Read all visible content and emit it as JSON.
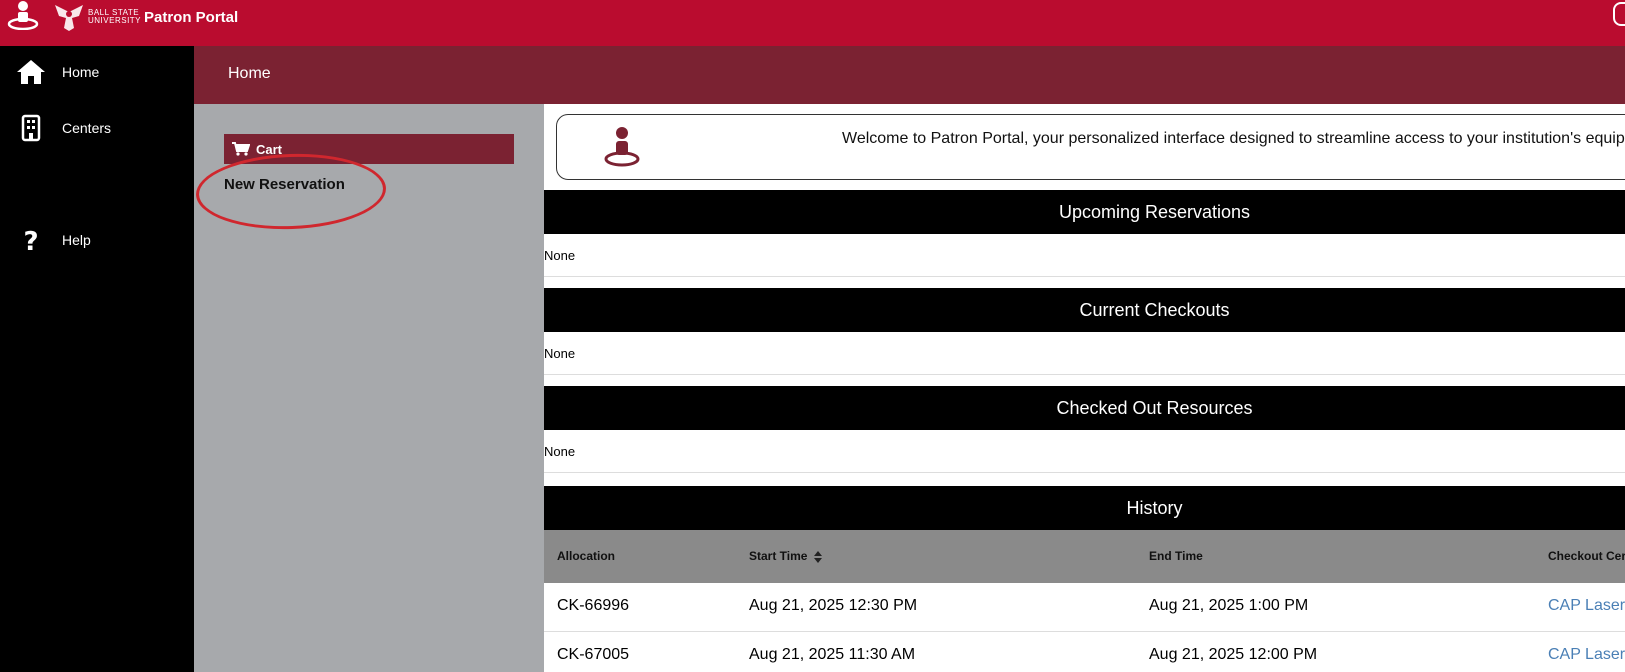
{
  "header": {
    "university_line1": "BALL STATE",
    "university_line2": "UNIVERSITY",
    "title": "Patron Portal"
  },
  "nav": {
    "items": [
      {
        "label": "Home",
        "icon": "home-icon"
      },
      {
        "label": "Centers",
        "icon": "building-icon"
      },
      {
        "label": "Help",
        "icon": "help-icon"
      }
    ]
  },
  "page": {
    "title": "Home"
  },
  "side_panel": {
    "cart_label": "Cart",
    "new_reservation_label": "New Reservation"
  },
  "welcome": {
    "text": "Welcome to Patron Portal, your personalized interface designed to streamline access to your institution's equip"
  },
  "sections": {
    "upcoming": {
      "title": "Upcoming Reservations",
      "body": "None"
    },
    "current": {
      "title": "Current Checkouts",
      "body": "None"
    },
    "checked_out": {
      "title": "Checked Out Resources",
      "body": "None"
    },
    "history": {
      "title": "History"
    }
  },
  "history_table": {
    "columns": [
      "Allocation",
      "Start Time",
      "End Time",
      "Checkout Cer"
    ],
    "rows": [
      {
        "allocation": "CK-66996",
        "start": "Aug 21, 2025 12:30 PM",
        "end": "Aug 21, 2025 1:00 PM",
        "center": "CAP Laser"
      },
      {
        "allocation": "CK-67005",
        "start": "Aug 21, 2025 11:30 AM",
        "end": "Aug 21, 2025 12:00 PM",
        "center": "CAP Laser"
      }
    ]
  },
  "colors": {
    "brand_red": "#ba0c2f",
    "maroon": "#7b2232",
    "link": "#4a7fb5",
    "annotation_circle": "#d0272e"
  }
}
